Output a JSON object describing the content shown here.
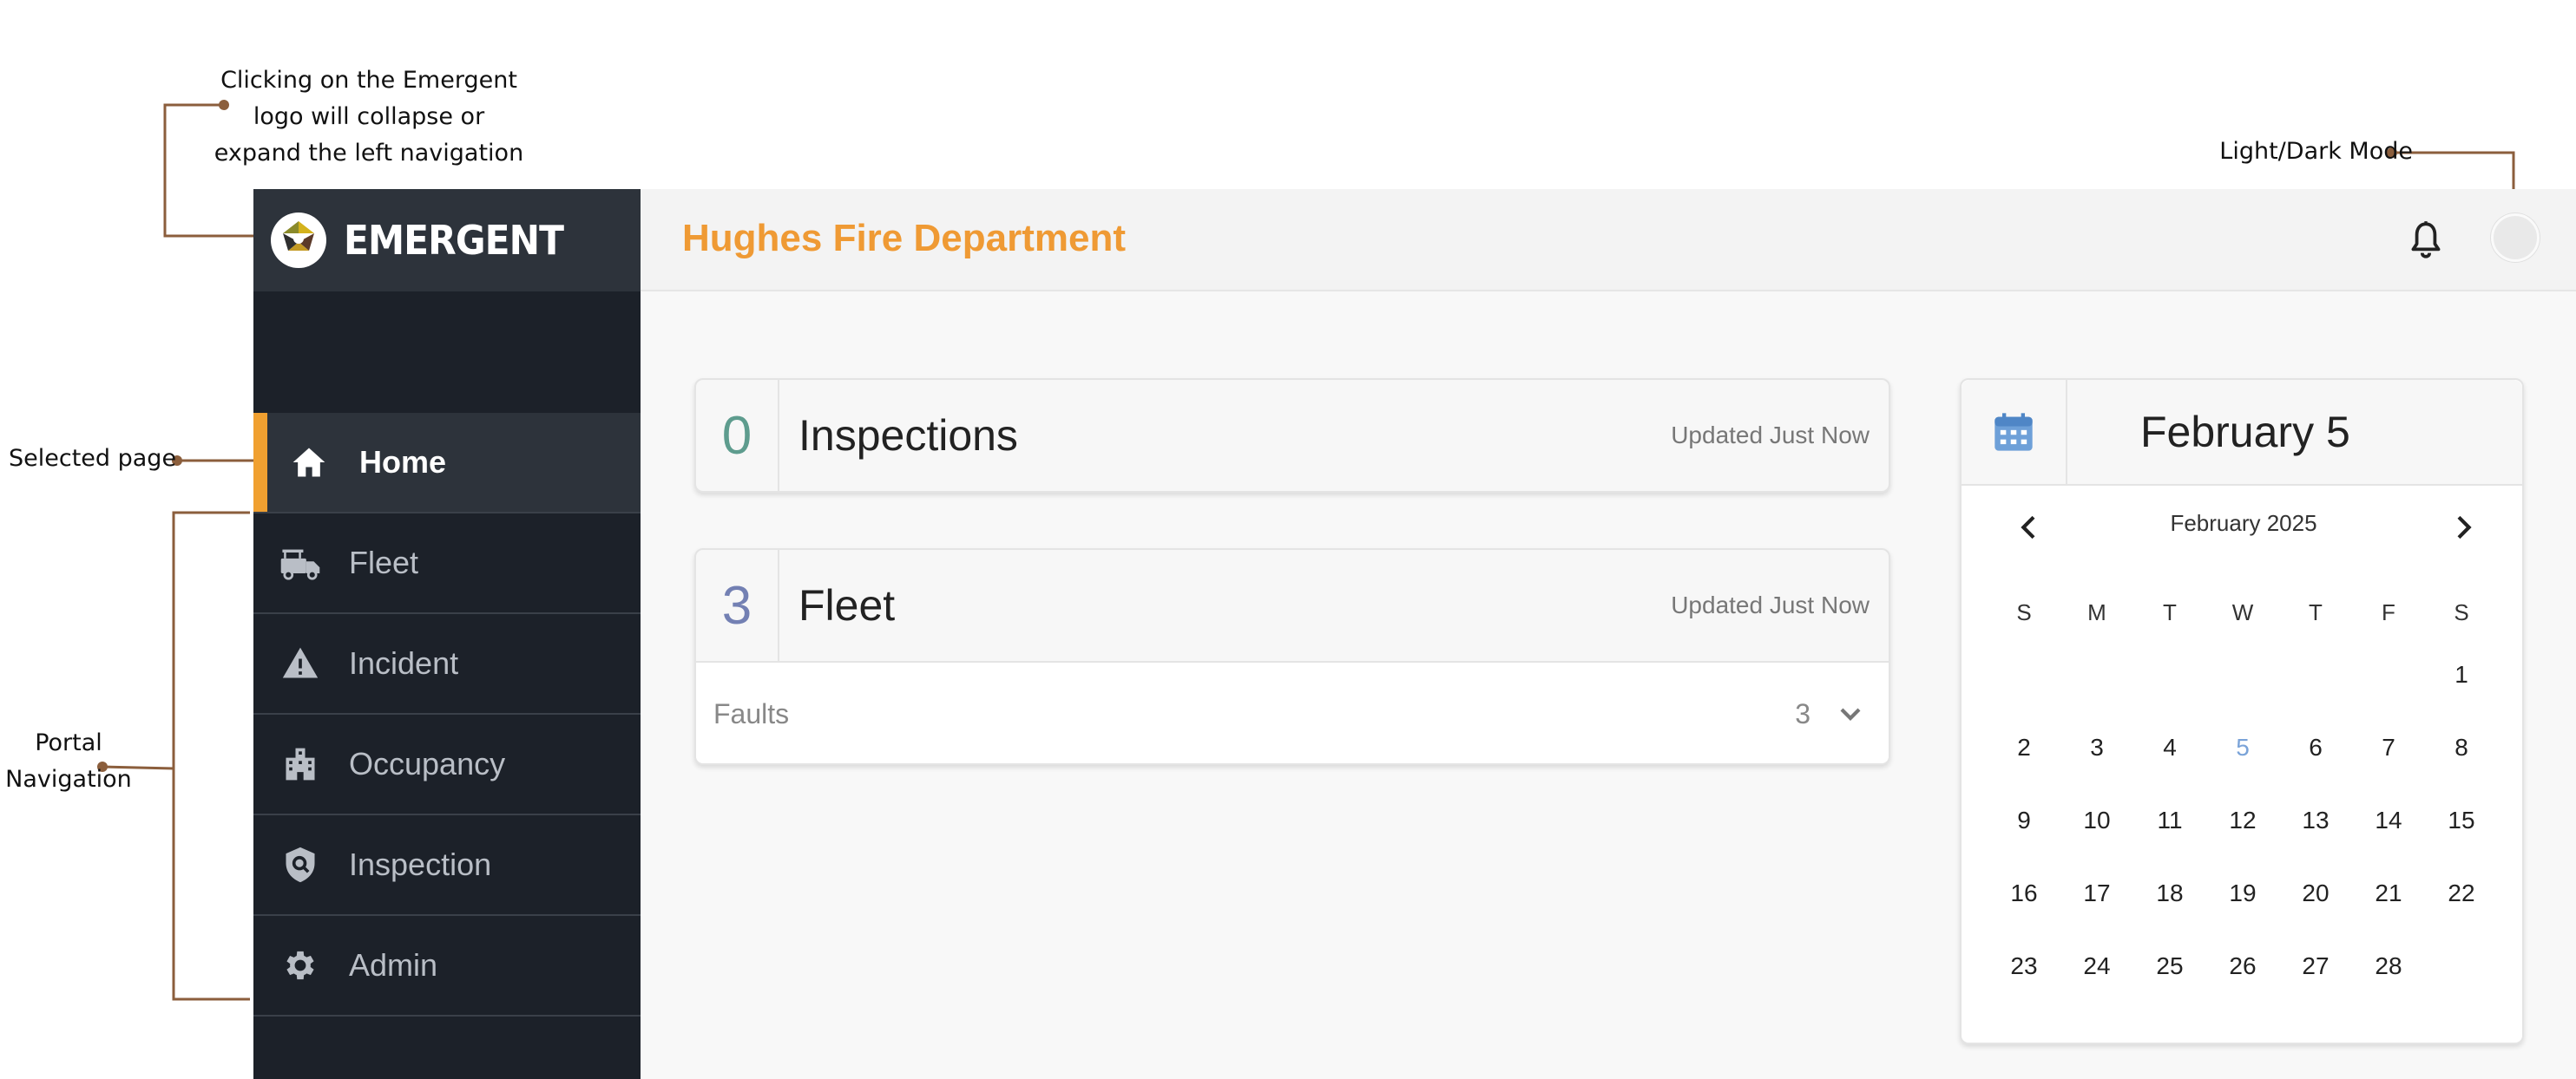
{
  "annotations": {
    "logo_note": [
      "Clicking on the Emergent",
      "logo will collapse or",
      "expand the left navigation"
    ],
    "mode_note": "Light/Dark Mode",
    "selected_note": "Selected page",
    "portal_note": [
      "Portal",
      "Navigation"
    ]
  },
  "sidebar": {
    "brand": "EMERGENT",
    "items": [
      {
        "label": "Home",
        "icon": "home-icon",
        "active": true
      },
      {
        "label": "Fleet",
        "icon": "fire-truck-icon"
      },
      {
        "label": "Incident",
        "icon": "warning-icon"
      },
      {
        "label": "Occupancy",
        "icon": "building-icon"
      },
      {
        "label": "Inspection",
        "icon": "shield-search-icon"
      },
      {
        "label": "Admin",
        "icon": "gear-icon"
      }
    ]
  },
  "header": {
    "title": "Hughes Fire Department",
    "icons": [
      "bell-icon",
      "light-dark-toggle"
    ]
  },
  "cards": {
    "inspections": {
      "count": "0",
      "title": "Inspections",
      "updated": "Updated Just Now"
    },
    "fleet": {
      "count": "3",
      "title": "Fleet",
      "updated": "Updated Just Now",
      "faults": {
        "label": "Faults",
        "count": "3"
      }
    }
  },
  "calendar": {
    "selected_date": "February 5",
    "month_label": "February 2025",
    "weekdays": [
      "S",
      "M",
      "T",
      "W",
      "T",
      "F",
      "S"
    ],
    "leading_blanks": 6,
    "days": [
      "1",
      "2",
      "3",
      "4",
      "5",
      "6",
      "7",
      "8",
      "9",
      "10",
      "11",
      "12",
      "13",
      "14",
      "15",
      "16",
      "17",
      "18",
      "19",
      "20",
      "21",
      "22",
      "23",
      "24",
      "25",
      "26",
      "27",
      "28"
    ],
    "today": "5"
  },
  "colors": {
    "accent": "#f0a030",
    "title": "#ef9a34",
    "sidebar_bg": "#1c2129",
    "annotation_line": "#8b5e3c"
  }
}
